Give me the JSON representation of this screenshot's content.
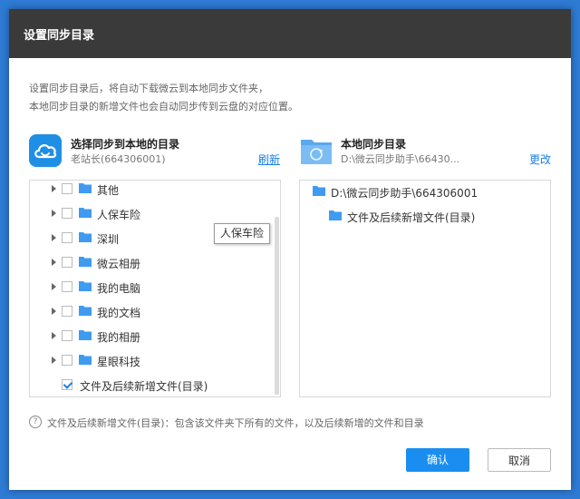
{
  "dialog": {
    "title": "设置同步目录",
    "description_line1": "设置同步目录后，将自动下载微云到本地同步文件夹，",
    "description_line2": "本地同步目录的新增文件也会自动同步传到云盘的对应位置。"
  },
  "cloud_section": {
    "title": "选择同步到本地的目录",
    "account": "老站长(664306001)",
    "refresh_label": "刷新",
    "logo_icon": "weiyun-cloud-icon",
    "logo_color": "#1f8fe6"
  },
  "local_section": {
    "title": "本地同步目录",
    "path": "D:\\微云同步助手\\66430...",
    "change_label": "更改",
    "logo_icon": "local-folder-icon"
  },
  "cloud_tree": {
    "items": [
      {
        "label": "其他"
      },
      {
        "label": "人保车险"
      },
      {
        "label": "深圳"
      },
      {
        "label": "微云相册"
      },
      {
        "label": "我的电脑"
      },
      {
        "label": "我的文档"
      },
      {
        "label": "我的相册"
      },
      {
        "label": "星眼科技"
      }
    ],
    "checked_item": {
      "label": "文件及后续新增文件(目录)"
    }
  },
  "local_tree": {
    "root": "D:\\微云同步助手\\664306001",
    "child": "文件及后续新增文件(目录)"
  },
  "tooltip": {
    "text": "人保车险"
  },
  "note": {
    "text": "文件及后续新增文件(目录)：包含该文件夹下所有的文件，以及后续新增的文件和目录"
  },
  "buttons": {
    "ok_label": "确认",
    "cancel_label": "取消"
  },
  "colors": {
    "accent": "#1a8ef0",
    "folder": "#3e9bf0",
    "titlebar": "#3a3a3a"
  }
}
